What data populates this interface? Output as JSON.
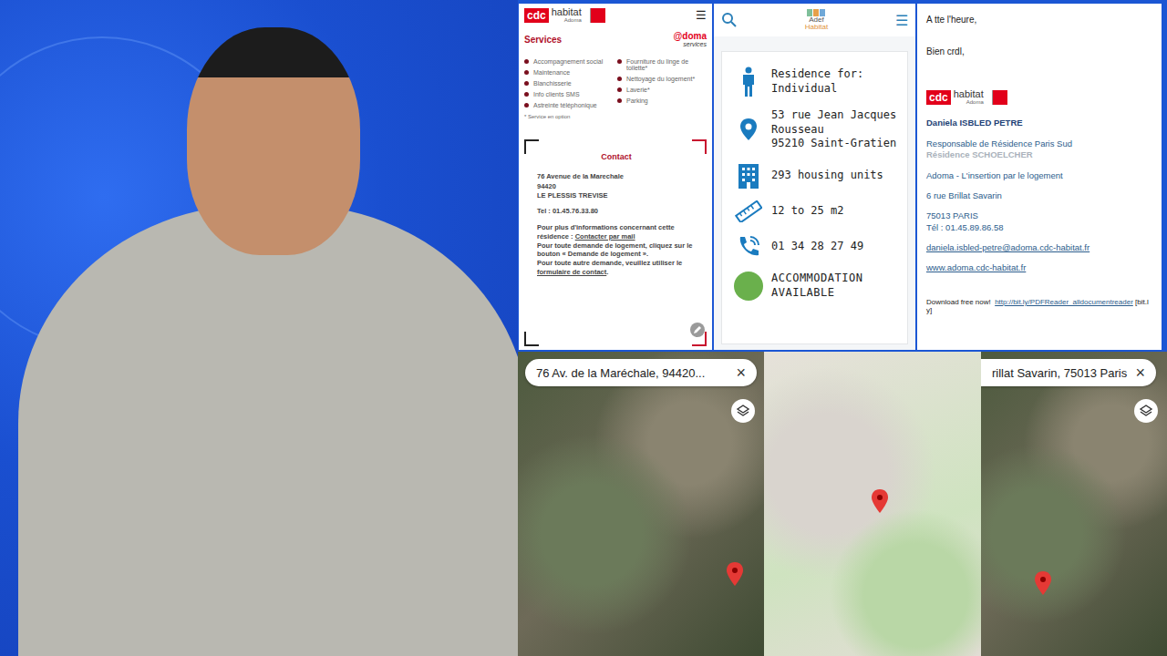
{
  "cdc_panel": {
    "logo": {
      "mark": "cdc",
      "word": "habitat",
      "sub": "Adoma"
    },
    "menu": "☰",
    "title": "Services",
    "services_logo": {
      "top": "@doma",
      "bottom": "services"
    },
    "services_left": [
      "Accompagnement social",
      "Maintenance",
      "Blanchisserie",
      "Info clients SMS",
      "Astreinte téléphonique"
    ],
    "services_right": [
      "Fourniture du linge de toilette*",
      "Nettoyage du logement*",
      "Laverie*",
      "Parking"
    ],
    "footnote": "* Service en option",
    "contact": {
      "title": "Contact",
      "address": [
        "76 Avenue de la Marechale",
        "94420",
        "LE PLESSIS TREVISE"
      ],
      "phone": "Tel : 01.45.76.33.80",
      "info_prefix": "Pour plus d'informations concernant cette résidence : ",
      "info_link": "Contacter par mail",
      "request": "Pour toute demande de logement, cliquez sur le bouton « Demande de logement ».",
      "other_prefix": "Pour toute autre demande, veuillez utiliser le ",
      "other_link": "formulaire de contact",
      "other_suffix": "."
    }
  },
  "adef_panel": {
    "logo_top": "Adef",
    "logo_bottom": "Habitat",
    "menu": "☰",
    "facts": [
      {
        "kind": "person",
        "lines": [
          "Residence for:",
          "Individual"
        ]
      },
      {
        "kind": "pin",
        "lines": [
          "53 rue Jean Jacques",
          "Rousseau",
          "95210 Saint-Gratien"
        ]
      },
      {
        "kind": "building",
        "lines": [
          "293 housing units"
        ]
      },
      {
        "kind": "ruler",
        "lines": [
          "12 to 25 m2"
        ]
      },
      {
        "kind": "phone",
        "lines": [
          "01 34 28 27 49"
        ]
      },
      {
        "kind": "status",
        "lines": [
          "ACCOMMODATION",
          "AVAILABLE"
        ],
        "color": "#6ab04c"
      }
    ]
  },
  "email": {
    "greeting": "A tte l'heure,",
    "closing": "Bien crdl,",
    "logo": {
      "mark": "cdc",
      "word": "habitat",
      "sub": "Adoma"
    },
    "name": "Daniela ISBLED PETRE",
    "role": "Responsable de Résidence Paris Sud",
    "residence": "Résidence SCHOELCHER",
    "org": "Adoma - L'insertion par le logement",
    "street": "6 rue Brillat Savarin",
    "city": "75013 PARIS",
    "phone": "Tél : 01.45.89.86.58",
    "address": "daniela.isbled-petre@adoma.cdc-habitat.fr",
    "website": "www.adoma.cdc-habitat.fr",
    "footer_prefix": "Download free now!",
    "footer_link": "http://bit.ly/PDFReader_alldocumentreader",
    "footer_suffix": "[bit.ly]"
  },
  "maps": [
    {
      "kind": "satellite",
      "search": "76 Av. de la Maréchale, 94420...",
      "close": "×",
      "layers": true
    },
    {
      "kind": "road",
      "search": "",
      "close": "",
      "layers": false
    },
    {
      "kind": "satellite",
      "search": "rillat Savarin, 75013 Paris",
      "close": "×",
      "layers": true
    }
  ]
}
